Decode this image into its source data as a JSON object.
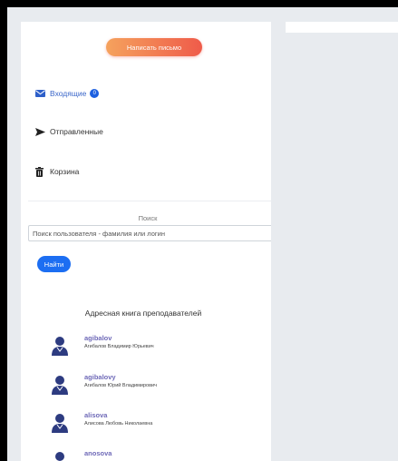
{
  "compose_label": "Написать письмо",
  "folders": [
    {
      "name": "Входящие",
      "icon": "envelope-icon",
      "badge": "0"
    },
    {
      "name": "Отправленные",
      "icon": "send-icon"
    },
    {
      "name": "Корзина",
      "icon": "trash-icon"
    }
  ],
  "search": {
    "title": "Поиск",
    "placeholder": "Поиск пользователя - фамилия или логин",
    "button_label": "Найти"
  },
  "address_book": {
    "title": "Адресная книга преподавателей",
    "contacts": [
      {
        "login": "agibalov",
        "name": "Агибалов Владимир Юрьевич"
      },
      {
        "login": "agibalovy",
        "name": "Агибалов Юрий Владимирович"
      },
      {
        "login": "alisova",
        "name": "Алисова Любовь Николаевна"
      },
      {
        "login": "anosova",
        "name": ""
      }
    ]
  },
  "colors": {
    "accent": "#1c6ef2",
    "compose_gradient_start": "#f5a25d",
    "compose_gradient_end": "#ef5b4a",
    "contact_login": "#6f6ab8",
    "avatar": "#2d3b80",
    "background": "#e8ebef"
  }
}
